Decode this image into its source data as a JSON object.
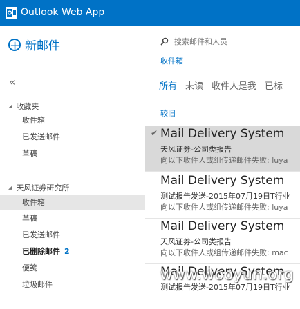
{
  "header": {
    "title": "Outlook Web App"
  },
  "left": {
    "new_mail": "新邮件",
    "collapse": "«",
    "favorites": {
      "label": "收藏夹",
      "items": [
        "收件箱",
        "已发送邮件",
        "草稿"
      ]
    },
    "account": {
      "label": "天风证券研究所",
      "items": [
        {
          "label": "收件箱"
        },
        {
          "label": "草稿"
        },
        {
          "label": "已发送邮件"
        },
        {
          "label": "已删除邮件",
          "count": "2"
        },
        {
          "label": "便笺"
        },
        {
          "label": "垃圾邮件"
        }
      ]
    }
  },
  "right": {
    "search_placeholder": "搜索邮件和人员",
    "scope": "收件箱",
    "filters": [
      "所有",
      "未读",
      "收件人是我",
      "已标"
    ],
    "group": "较旧",
    "messages": [
      {
        "sender": "Mail Delivery System",
        "subject": "天风证券-公司类报告",
        "preview": "向以下收件人或组传递邮件失败: luya"
      },
      {
        "sender": "Mail Delivery System",
        "subject": "测试报告发送-2015年07月19日T行业",
        "preview": "向以下收件人或组传递邮件失败: luya"
      },
      {
        "sender": "Mail Delivery System",
        "subject": "天风证券-公司类报告",
        "preview": "向以下收件人或组传递邮件失败: mac"
      },
      {
        "sender": "Mail Delivery System",
        "subject": "测试报告发送-2015年07月19日T行业",
        "preview": ""
      }
    ]
  },
  "watermark": "www.wooyun.org"
}
